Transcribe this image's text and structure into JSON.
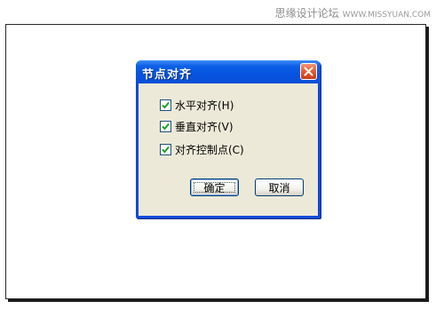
{
  "watermark": {
    "site_name": "思缘设计论坛",
    "site_url": "WWW.MISSYUAN.COM"
  },
  "dialog": {
    "title": "节点对齐",
    "options": [
      {
        "label": "水平对齐(H)",
        "checked": true
      },
      {
        "label": "垂直对齐(V)",
        "checked": true
      },
      {
        "label": "对齐控制点(C)",
        "checked": true
      }
    ],
    "ok_label": "确定",
    "cancel_label": "取消"
  },
  "colors": {
    "titlebar": "#0a4fd6",
    "client": "#ece9d8",
    "close_button": "#e45a2e",
    "checkmark": "#21a121"
  }
}
